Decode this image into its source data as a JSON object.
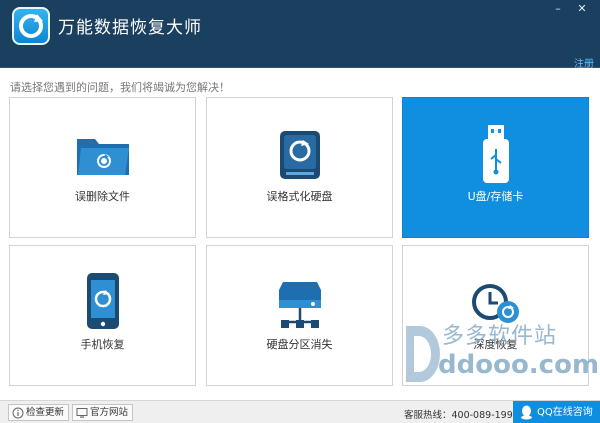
{
  "app": {
    "title": "万能数据恢复大师",
    "register": "注册"
  },
  "window_controls": {
    "minimize": "–",
    "close": "✕"
  },
  "prompt": "请选择您遇到的问题，我们将竭诚为您解决！",
  "cards": [
    {
      "label": "误删除文件",
      "icon": "folder-refresh-icon"
    },
    {
      "label": "误格式化硬盘",
      "icon": "hard-disk-icon"
    },
    {
      "label": "U盘/存储卡",
      "icon": "usb-drive-icon",
      "selected": true
    },
    {
      "label": "手机恢复",
      "icon": "phone-refresh-icon"
    },
    {
      "label": "硬盘分区消失",
      "icon": "partition-disk-icon"
    },
    {
      "label": "深度恢复",
      "icon": "clock-refresh-icon"
    }
  ],
  "footer": {
    "check_update": "检查更新",
    "official_site": "官方网站",
    "hotline": "客服热线：400-089-1998",
    "qq_consult": "QQ在线咨询"
  },
  "watermark": {
    "cn": "多多软件站",
    "en": "ddooo.com"
  },
  "colors": {
    "titlebar": "#1a3f5f",
    "accent": "#108ee0",
    "selected_card": "#108ee0"
  }
}
